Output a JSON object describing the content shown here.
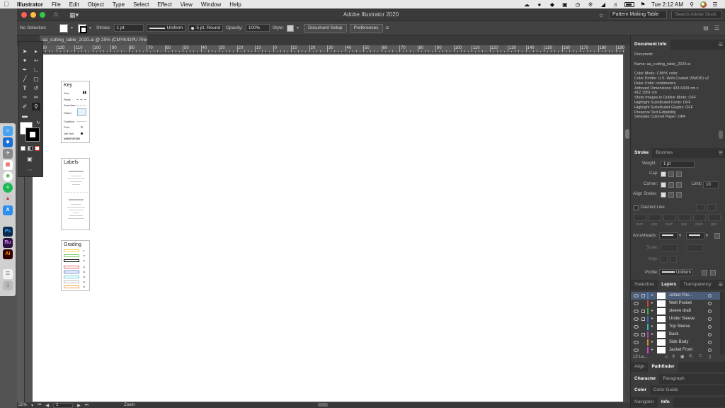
{
  "menubar": {
    "apple_icon": "apple-icon",
    "app_name": "Illustrator",
    "items": [
      "File",
      "Edit",
      "Object",
      "Type",
      "Select",
      "Effect",
      "View",
      "Window",
      "Help"
    ],
    "clock": "Tue 2:12 AM"
  },
  "window": {
    "title": "Adobe Illustrator 2020",
    "workspace": "Pattern Making Table",
    "stock_placeholder": "Search Adobe Stock"
  },
  "controlbar": {
    "selection": "No Selection",
    "stroke_label": "Stroke:",
    "stroke_weight": "1 pt",
    "profile": "Uniform",
    "brush": "5 pt. Round",
    "opacity_label": "Opacity:",
    "opacity_value": "100%",
    "style_label": "Style:",
    "document_setup": "Document Setup",
    "preferences": "Preferences"
  },
  "document": {
    "tab_title": "aa_cutting_table_2020.ai @ 25% (CMYK/GPU Preview)"
  },
  "ruler": {
    "labels": [
      "130",
      "120",
      "110",
      "100",
      "90",
      "80",
      "70",
      "60",
      "50",
      "40",
      "30",
      "20",
      "10",
      "0",
      "10",
      "20",
      "30",
      "40",
      "50",
      "60",
      "70",
      "80",
      "90",
      "100",
      "110",
      "120",
      "130",
      "140",
      "150",
      "160",
      "170",
      "180",
      "190"
    ]
  },
  "artboards": {
    "key": {
      "title": "Key",
      "rows": [
        "Cuts",
        "Pleats",
        "Seamlines",
        "Pattern",
        "Guideline",
        "Point",
        "Drill Hole",
        "ANNOTATION"
      ]
    },
    "labels": {
      "title": "Labels"
    },
    "grading": {
      "title": "Grading",
      "values": [
        "8",
        "10",
        "12",
        "14",
        "16",
        "18",
        "20",
        "22"
      ],
      "colors": [
        "#f4d35e",
        "#7dc96a",
        "#111111",
        "#e07070",
        "#5577cc",
        "#66cccc",
        "#bbbbbb",
        "#f0a050"
      ]
    }
  },
  "statusbar": {
    "zoom": "25%",
    "page": "1",
    "tool": "Zoom"
  },
  "document_info": {
    "tab": "Document Info",
    "lines": [
      "Document:",
      "",
      "Name: aa_cutting_table_2020.ai",
      "",
      "Color Mode: CMYK color",
      "Color Profile: U.S. Web Coated (SWOP) v2",
      "Ruler Units: centimeters",
      "Artboard Dimensions: 433.6309 cm x",
      "412.1581 cm",
      "Show Images in Outline Mode: OFF",
      "Highlight Substituted Fonts: OFF",
      "Highlight Substituted Glyphs: OFF",
      "Preserve Text Editability",
      "Simulate Colored Paper: OFF"
    ]
  },
  "stroke_panel": {
    "tabs": [
      "Stroke",
      "Brushes"
    ],
    "weight_label": "Weight:",
    "weight_value": "1 pt",
    "cap_label": "Cap:",
    "corner_label": "Corner:",
    "limit_label": "Limit:",
    "limit_value": "10",
    "align_label": "Align Stroke:",
    "dashed_label": "Dashed Line",
    "dash_labels": [
      "dash",
      "gap",
      "dash",
      "gap",
      "dash",
      "gap"
    ],
    "arrowheads_label": "Arrowheads:",
    "scale_label": "Scale:",
    "align2_label": "Align:",
    "profile_label": "Profile:",
    "profile_value": "Uniform"
  },
  "layers_panel": {
    "tabs": [
      "Swatches",
      "Layers",
      "Transparency"
    ],
    "count": "13 La...",
    "layers": [
      {
        "name": "Jetted Poc...",
        "color": "#4f7fd0",
        "locked": true
      },
      {
        "name": "Welt Pocket",
        "color": "#cc4444",
        "locked": false
      },
      {
        "name": "sleeve draft",
        "color": "#44aa44",
        "locked": true
      },
      {
        "name": "Under Sleeve",
        "color": "#4466cc",
        "locked": true
      },
      {
        "name": "Top Sleeve",
        "color": "#33bbbb",
        "locked": false
      },
      {
        "name": "Back",
        "color": "#aa44aa",
        "locked": true
      },
      {
        "name": "Side Body",
        "color": "#dd8833",
        "locked": false
      },
      {
        "name": "Jacket Front",
        "color": "#cc44cc",
        "locked": false
      }
    ]
  },
  "bottom_panels": {
    "align_tabs": [
      "Align",
      "Pathfinder"
    ],
    "char_tabs": [
      "Character",
      "Paragraph"
    ],
    "color_tabs": [
      "Color",
      "Color Guide"
    ],
    "nav_tabs": [
      "Navigator",
      "Info"
    ]
  },
  "dock": {
    "apps": [
      "finder",
      "dropbox",
      "launchpad",
      "calendar",
      "chrome",
      "spotify",
      "rocket",
      "appstore",
      "Ps",
      "Ru",
      "Ai",
      "notes",
      "trash"
    ]
  }
}
